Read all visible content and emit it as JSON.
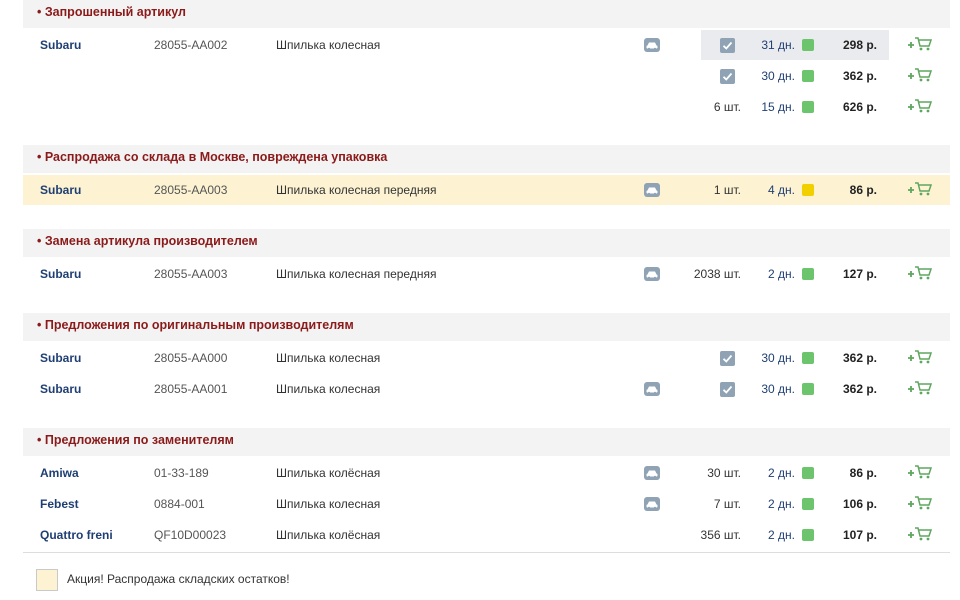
{
  "colors": {
    "section_title": "#8b1a1a",
    "brand": "#1f3f73",
    "promo_row": "#fdf3d3",
    "status_green": "#6cc46c",
    "status_yellow": "#f2d000",
    "cart": "#5fa65f"
  },
  "icons": {
    "car": "car-icon",
    "check": "checkbox-checked-icon",
    "cart": "add-to-cart-icon"
  },
  "sections": [
    {
      "title": "• Запрошенный артикул",
      "rows": [
        {
          "brand": "Subaru",
          "article": "28055-AA002",
          "desc": "Шпилька колесная",
          "car": true,
          "qty": "",
          "check": true,
          "days": "31 дн.",
          "status": "green",
          "price": "298 р."
        },
        {
          "brand": "",
          "article": "",
          "desc": "",
          "car": false,
          "qty": "",
          "check": true,
          "days": "30 дн.",
          "status": "green",
          "price": "362 р."
        },
        {
          "brand": "",
          "article": "",
          "desc": "",
          "car": false,
          "qty": "6 шт.",
          "check": false,
          "days": "15 дн.",
          "status": "green",
          "price": "626 р."
        }
      ]
    },
    {
      "title": "• Распродажа со склада в Москве, повреждена упаковка",
      "rows": [
        {
          "brand": "Subaru",
          "article": "28055-AA003",
          "desc": "Шпилька колесная передняя",
          "car": true,
          "qty": "1 шт.",
          "check": false,
          "days": "4 дн.",
          "status": "yellow",
          "price": "86 р.",
          "promo": true
        }
      ]
    },
    {
      "title": "• Замена артикула производителем",
      "rows": [
        {
          "brand": "Subaru",
          "article": "28055-AA003",
          "desc": "Шпилька колесная передняя",
          "car": true,
          "qty": "2038 шт.",
          "check": false,
          "days": "2 дн.",
          "status": "green",
          "price": "127 р."
        }
      ]
    },
    {
      "title": "• Предложения по оригинальным производителям",
      "rows": [
        {
          "brand": "Subaru",
          "article": "28055-AA000",
          "desc": "Шпилька колесная",
          "car": false,
          "qty": "",
          "check": true,
          "days": "30 дн.",
          "status": "green",
          "price": "362 р."
        },
        {
          "brand": "Subaru",
          "article": "28055-AA001",
          "desc": "Шпилька колесная",
          "car": true,
          "qty": "",
          "check": true,
          "days": "30 дн.",
          "status": "green",
          "price": "362 р."
        }
      ]
    },
    {
      "title": "• Предложения по заменителям",
      "rows": [
        {
          "brand": "Amiwa",
          "article": "01-33-189",
          "desc": "Шпилька колёсная",
          "car": true,
          "qty": "30 шт.",
          "check": false,
          "days": "2 дн.",
          "status": "green",
          "price": "86 р."
        },
        {
          "brand": "Febest",
          "article": "0884-001",
          "desc": "Шпилька колесная",
          "car": true,
          "qty": "7 шт.",
          "check": false,
          "days": "2 дн.",
          "status": "green",
          "price": "106 р."
        },
        {
          "brand": "Quattro freni",
          "article": "QF10D00023",
          "desc": "Шпилька колёсная",
          "car": false,
          "qty": "356 шт.",
          "check": false,
          "days": "2 дн.",
          "status": "green",
          "price": "107 р."
        }
      ]
    }
  ],
  "legend": {
    "text": "Акция! Распродажа складских остатков!"
  }
}
